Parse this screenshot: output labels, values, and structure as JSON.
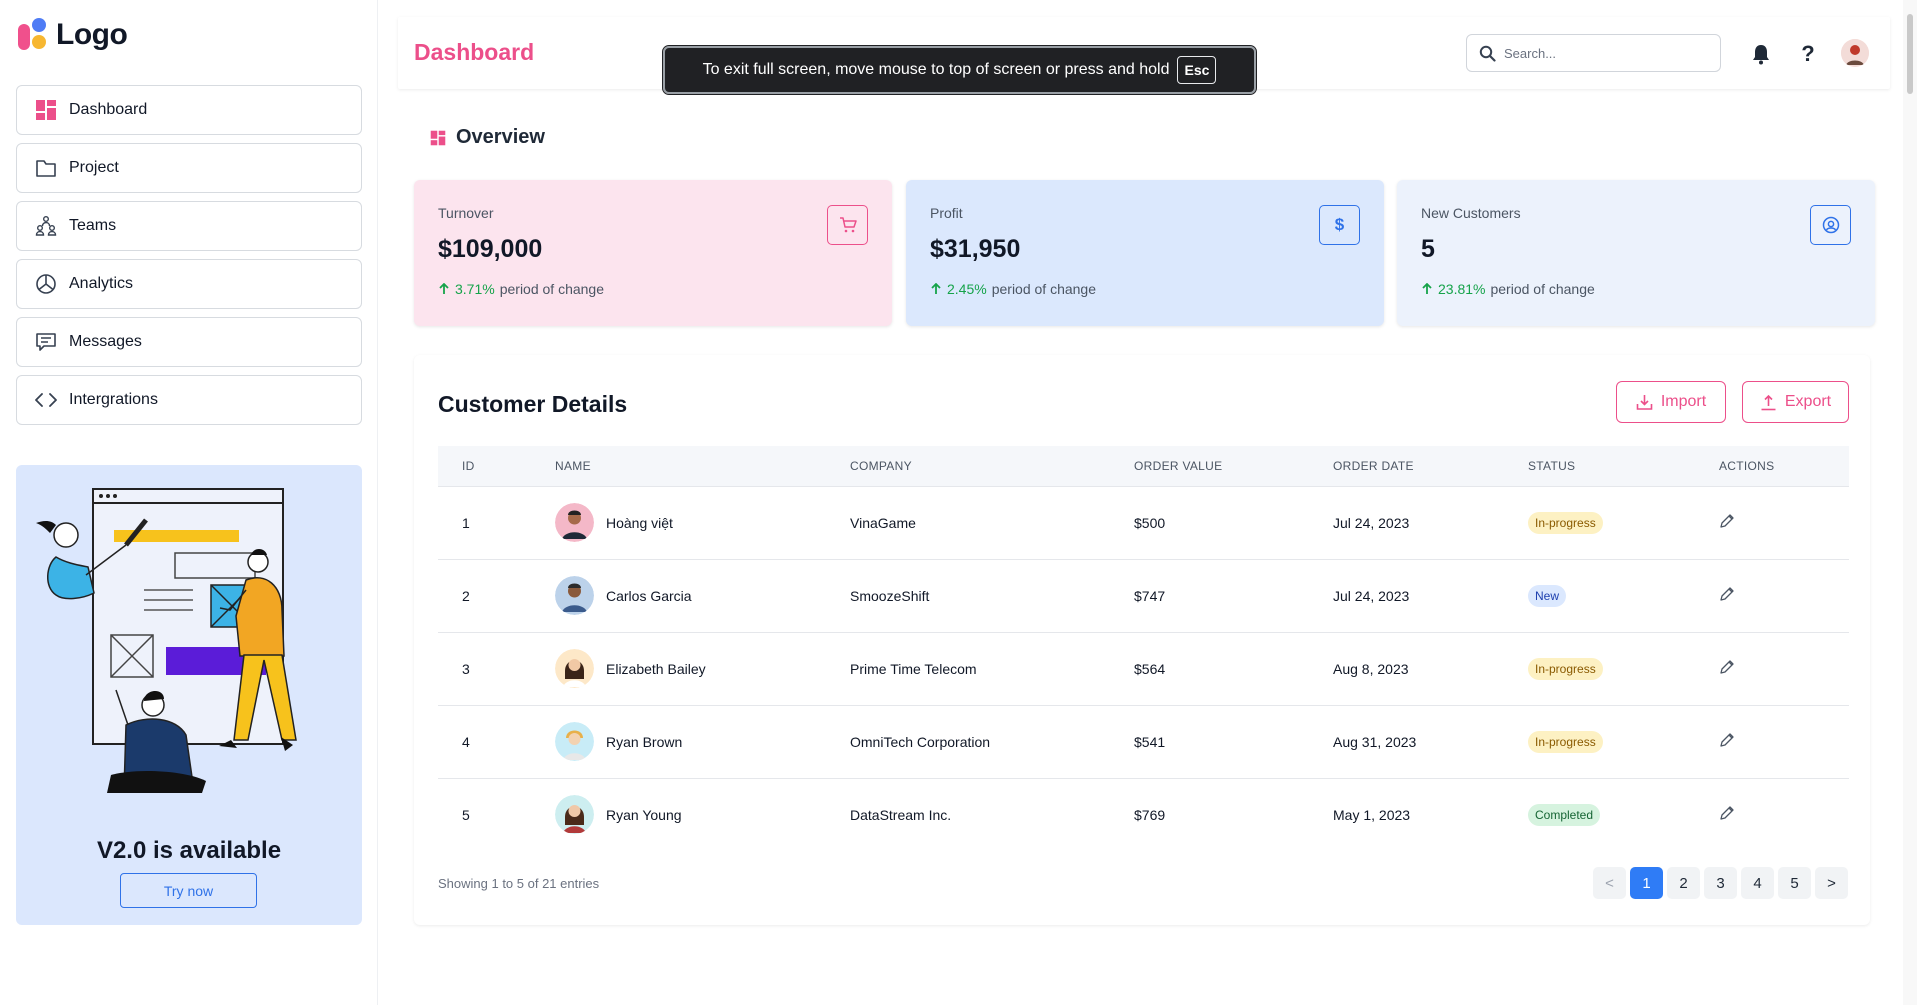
{
  "app": {
    "logo_text": "Logo"
  },
  "sidebar": {
    "items": [
      {
        "label": "Dashboard",
        "icon": "dashboard-icon"
      },
      {
        "label": "Project",
        "icon": "folder-icon"
      },
      {
        "label": "Teams",
        "icon": "teams-icon"
      },
      {
        "label": "Analytics",
        "icon": "chart-pie-icon"
      },
      {
        "label": "Messages",
        "icon": "message-icon"
      },
      {
        "label": "Intergrations",
        "icon": "code-icon"
      }
    ],
    "promo": {
      "title": "V2.0 is available",
      "button_label": "Try now"
    }
  },
  "header": {
    "title": "Dashboard",
    "search_placeholder": "Search...",
    "icons": [
      "search-icon",
      "bell-icon",
      "help-icon",
      "avatar"
    ]
  },
  "fullscreen_notice": {
    "text": "To exit full screen, move mouse to top of screen or press and hold",
    "key": "Esc"
  },
  "overview": {
    "title": "Overview",
    "cards": [
      {
        "label": "Turnover",
        "value": "$109,000",
        "change": "3.71%",
        "change_suffix": "period of change",
        "icon": "cart-icon",
        "bg": "#fce4ee",
        "accent": "#ec4f8a"
      },
      {
        "label": "Profit",
        "value": "$31,950",
        "change": "2.45%",
        "change_suffix": "period of change",
        "icon": "dollar-icon",
        "bg": "#dbe8fd",
        "accent": "#2f72e8"
      },
      {
        "label": "New Customers",
        "value": "5",
        "change": "23.81%",
        "change_suffix": "period of change",
        "icon": "user-circle-icon",
        "bg": "#ecf2fc",
        "accent": "#2f72e8"
      }
    ]
  },
  "customers": {
    "title": "Customer Details",
    "import_label": "Import",
    "export_label": "Export",
    "columns": [
      "ID",
      "NAME",
      "COMPANY",
      "ORDER VALUE",
      "ORDER DATE",
      "STATUS",
      "ACTIONS"
    ],
    "rows": [
      {
        "id": "1",
        "name": "Hoàng việt",
        "company": "VinaGame",
        "order_value": "$500",
        "order_date": "Jul 24, 2023",
        "status": "In-progress"
      },
      {
        "id": "2",
        "name": "Carlos Garcia",
        "company": "SmoozeShift",
        "order_value": "$747",
        "order_date": "Jul 24, 2023",
        "status": "New"
      },
      {
        "id": "3",
        "name": "Elizabeth Bailey",
        "company": "Prime Time Telecom",
        "order_value": "$564",
        "order_date": "Aug 8, 2023",
        "status": "In-progress"
      },
      {
        "id": "4",
        "name": "Ryan Brown",
        "company": "OmniTech Corporation",
        "order_value": "$541",
        "order_date": "Aug 31, 2023",
        "status": "In-progress"
      },
      {
        "id": "5",
        "name": "Ryan Young",
        "company": "DataStream Inc.",
        "order_value": "$769",
        "order_date": "May 1, 2023",
        "status": "Completed"
      }
    ],
    "showing": "Showing 1 to 5 of 21 entries",
    "pagination": {
      "prev": "<",
      "pages": [
        "1",
        "2",
        "3",
        "4",
        "5"
      ],
      "next": ">",
      "current": "1"
    }
  }
}
